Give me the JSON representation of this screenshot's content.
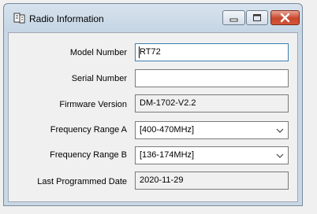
{
  "window": {
    "title": "Radio Information",
    "icon": "radio-app-icon",
    "controls": [
      "minimize-icon",
      "maximize-icon",
      "close-icon"
    ]
  },
  "form": {
    "model_number": {
      "label": "Model Number",
      "value": "RT72"
    },
    "serial_number": {
      "label": "Serial Number",
      "value": ""
    },
    "firmware_version": {
      "label": "Firmware Version",
      "value": "DM-1702-V2.2"
    },
    "frequency_range_a": {
      "label": "Frequency Range A",
      "value": "[400-470MHz]"
    },
    "frequency_range_b": {
      "label": "Frequency Range B",
      "value": "[136-174MHz]"
    },
    "last_programmed_date": {
      "label": "Last Programmed Date",
      "value": "2020-11-29"
    }
  },
  "colors": {
    "titlebar": "#c9d8e6",
    "close_button": "#c8452b",
    "focus_border": "#3c7fb1"
  }
}
